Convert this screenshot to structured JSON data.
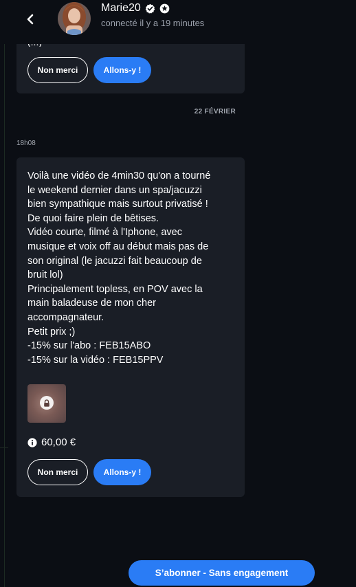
{
  "header": {
    "name": "Marie20",
    "status": "connecté il y a 19 minutes"
  },
  "previous_message": {
    "truncated_text": "(...)",
    "decline_label": "Non merci",
    "accept_label": "Allons-y !"
  },
  "date_separator": "22 FÉVRIER",
  "message": {
    "time": "18h08",
    "lines": [
      "Voilà une vidéo de 4min30 qu'on a tourné",
      "le weekend dernier dans un spa/jacuzzi",
      "bien sympathique mais surtout privatisé !",
      "De quoi faire plein de bêtises.",
      "Vidéo courte, filmé à l'Iphone, avec",
      "musique et voix off au début mais pas de",
      "son original (le jacuzzi fait beaucoup de",
      "bruit lol)",
      "Principalement topless, en POV avec la",
      "main baladeuse de mon cher",
      "accompagnateur.",
      "Petit prix ;)",
      "-15% sur l'abo : FEB15ABO",
      "-15% sur la vidéo : FEB15PPV"
    ],
    "price": "60,00 €",
    "decline_label": "Non merci",
    "accept_label": "Allons-y !"
  },
  "subscribe_label": "S’abonner - Sans engagement",
  "colors": {
    "background": "#0b0e14",
    "card": "#1a1e26",
    "accent": "#2a7cf5",
    "muted_text": "#9aa0ab"
  },
  "icons": [
    "back-arrow-icon",
    "verified-badge-icon",
    "star-badge-icon",
    "lock-icon",
    "info-icon"
  ]
}
